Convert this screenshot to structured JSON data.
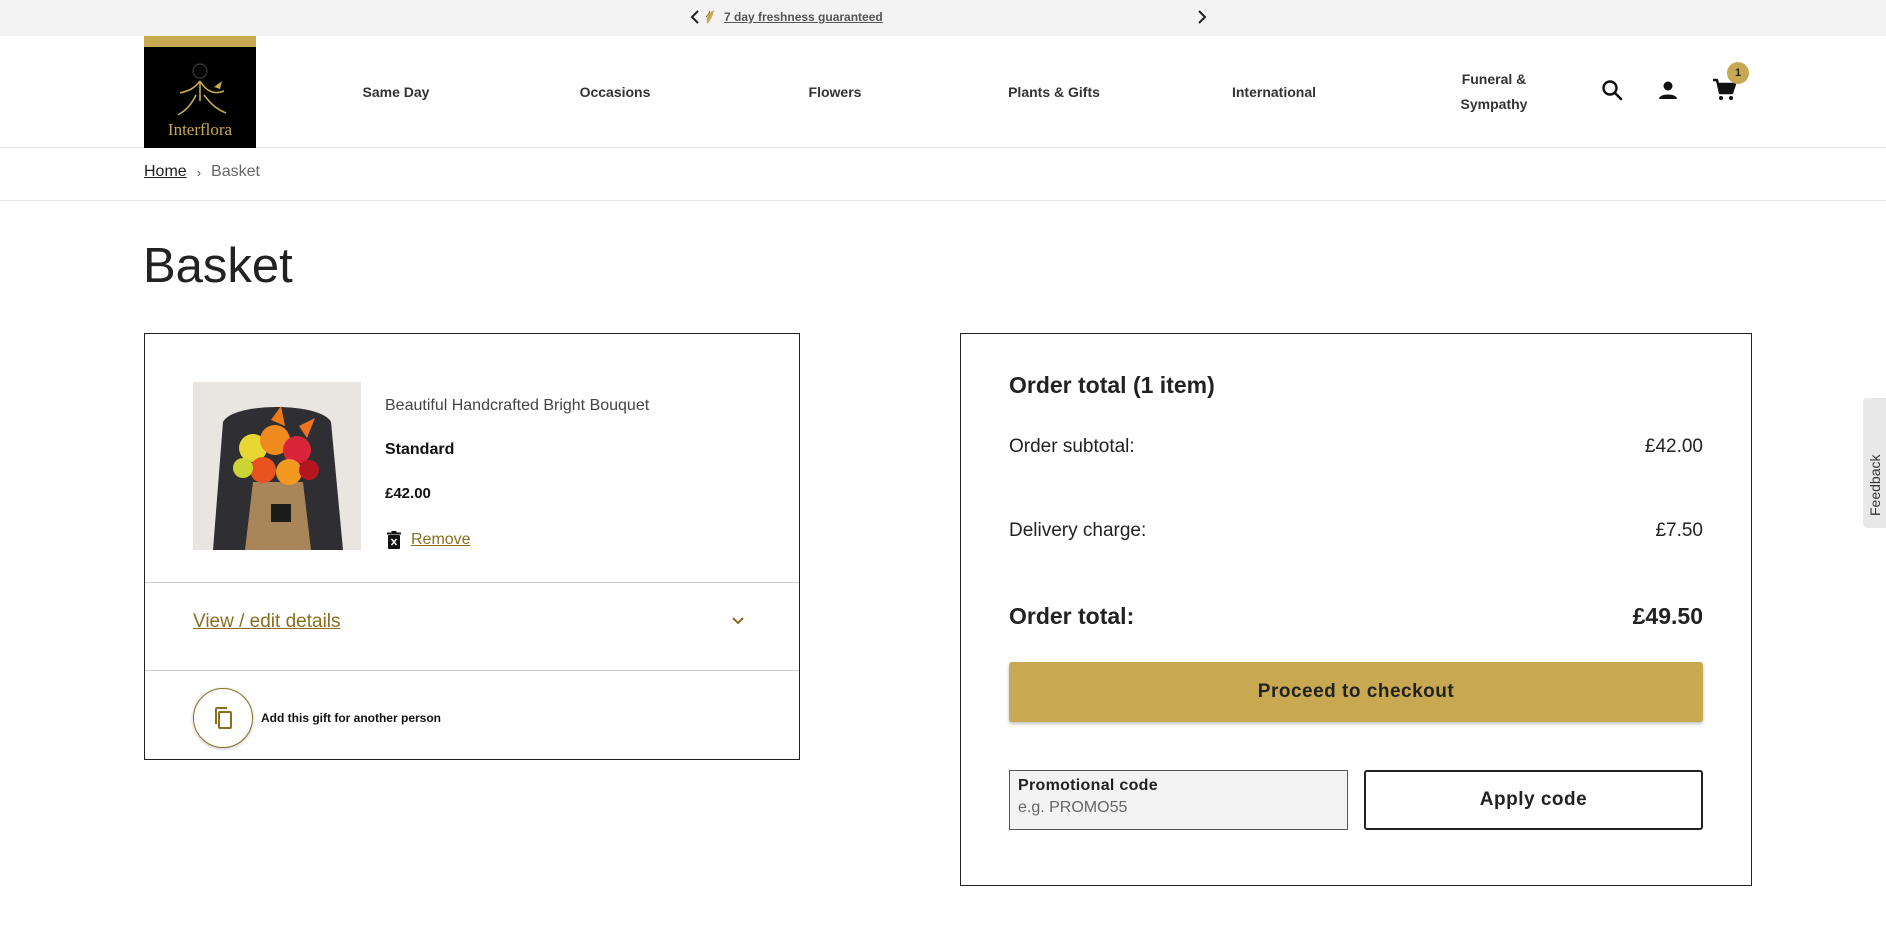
{
  "promo_bar": {
    "message": "7 day freshness guaranteed",
    "prev_icon": "chevron-left-icon",
    "next_icon": "chevron-right-icon"
  },
  "header": {
    "logo_text": "Interflora",
    "nav": [
      {
        "label": "Same Day"
      },
      {
        "label": "Occasions"
      },
      {
        "label": "Flowers"
      },
      {
        "label": "Plants & Gifts"
      },
      {
        "label": "International"
      },
      {
        "label": "Funeral & Sympathy"
      }
    ],
    "icons": [
      "search-icon",
      "account-icon",
      "cart-icon"
    ],
    "cart_count": "1"
  },
  "breadcrumb": {
    "home": "Home",
    "separator": "›",
    "current": "Basket"
  },
  "page_title": "Basket",
  "basket": {
    "item": {
      "name": "Beautiful Handcrafted Bright Bouquet",
      "size": "Standard",
      "price": "£42.00",
      "remove_label": "Remove"
    },
    "details_label": "View / edit details",
    "add_gift_label": "Add this gift for another person"
  },
  "summary": {
    "title": "Order total (1 item)",
    "subtotal_label": "Order subtotal:",
    "subtotal_value": "£42.00",
    "delivery_label": "Delivery charge:",
    "delivery_value": "£7.50",
    "total_label": "Order total:",
    "total_value": "£49.50",
    "checkout_label": "Proceed to checkout",
    "promo_label": "Promotional code",
    "promo_placeholder": "e.g. PROMO55",
    "apply_label": "Apply code"
  },
  "feedback_label": "Feedback",
  "colors": {
    "gold": "#c8a951",
    "link_brown": "#8a6d1f",
    "text": "#222222",
    "promo_bar_bg": "#f3f3f3"
  }
}
